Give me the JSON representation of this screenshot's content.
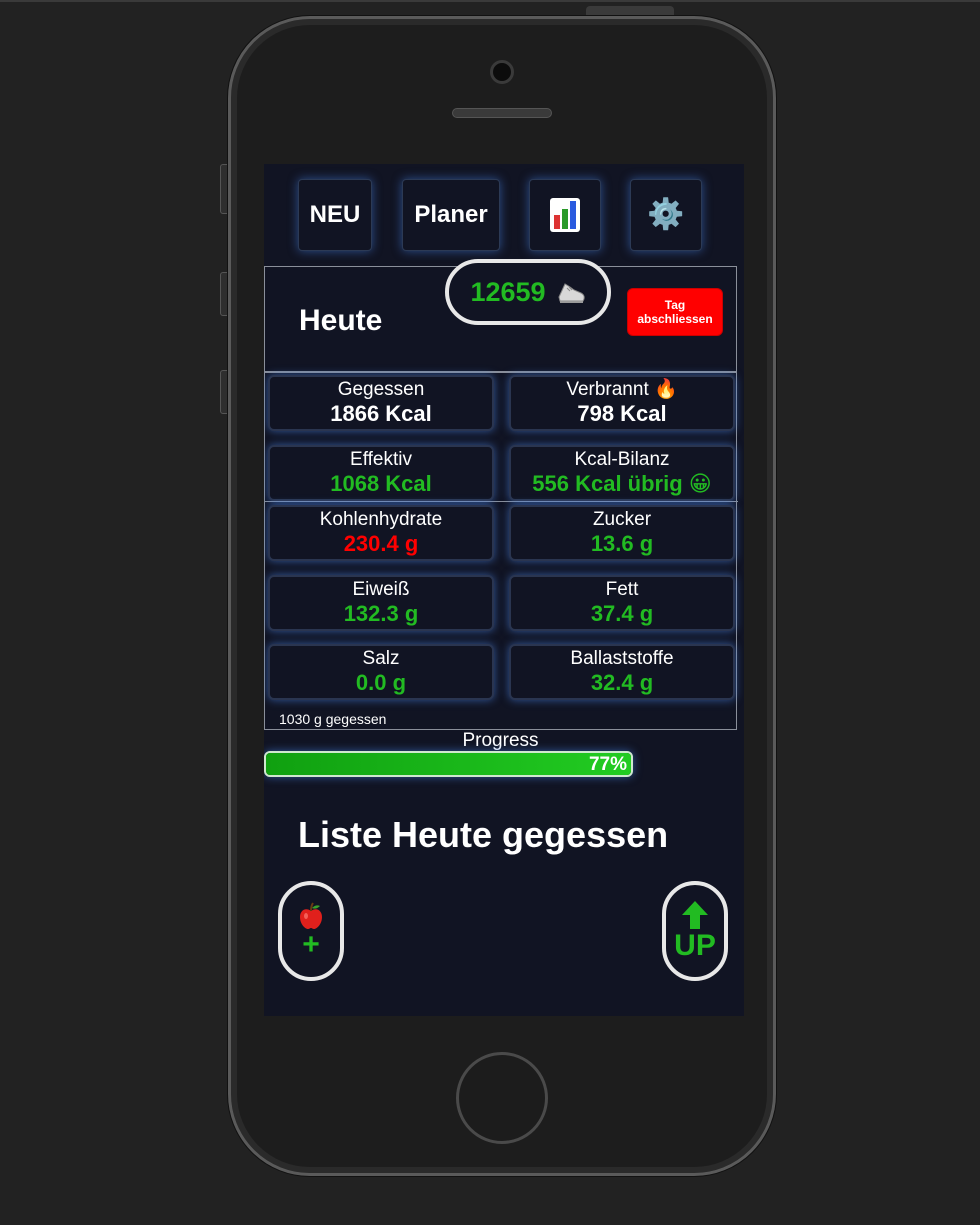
{
  "nav": {
    "neu_label": "NEU",
    "planer_label": "Planer",
    "chart_icon": "bar-chart-icon",
    "settings_icon": "gear-icon",
    "settings_glyph": "⚙️"
  },
  "today": {
    "title": "Heute",
    "steps": "12659",
    "steps_icon": "shoe-icon",
    "close_day_line1": "Tag",
    "close_day_line2": "abschliessen"
  },
  "stats": [
    {
      "label": "Gegessen",
      "value": "1866 Kcal",
      "color": "#ffffff"
    },
    {
      "label": "Verbrannt 🔥",
      "value": "798 Kcal",
      "color": "#ffffff"
    },
    {
      "label": "Effektiv",
      "value": "1068 Kcal",
      "color": "#22bb22"
    },
    {
      "label": "Kcal-Bilanz",
      "value": "556 Kcal übrig 😀",
      "color": "#22bb22"
    },
    {
      "label": "Kohlenhydrate",
      "value": "230.4 g",
      "color": "#ff0000"
    },
    {
      "label": "Zucker",
      "value": "13.6 g",
      "color": "#22bb22"
    },
    {
      "label": "Eiweiß",
      "value": "132.3 g",
      "color": "#22bb22"
    },
    {
      "label": "Fett",
      "value": "37.4 g",
      "color": "#22bb22"
    },
    {
      "label": "Salz",
      "value": "0.0 g",
      "color": "#22bb22"
    },
    {
      "label": "Ballaststoffe",
      "value": "32.4 g",
      "color": "#22bb22"
    }
  ],
  "eaten_grams": "1030 g gegessen",
  "progress": {
    "label": "Progress",
    "text": "77%",
    "fraction": 1.0
  },
  "list": {
    "title": "Liste Heute gegessen"
  },
  "actions": {
    "add_icon": "apple-icon",
    "add_label": "+",
    "up_icon": "arrow-up-icon",
    "up_label": "UP"
  },
  "colors": {
    "accent_green": "#22bb22",
    "warn_red": "#ff0000",
    "screen_bg": "#111423"
  }
}
